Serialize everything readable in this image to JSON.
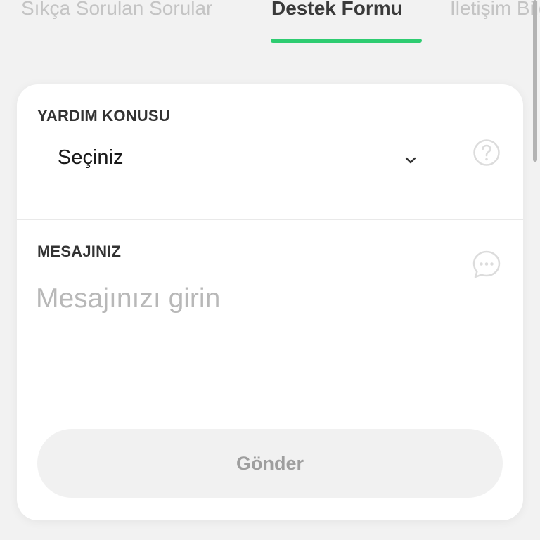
{
  "tabs": [
    {
      "label": "Sıkça Sorulan Sorular",
      "active": false
    },
    {
      "label": "Destek Formu",
      "active": true
    },
    {
      "label": "İletişim Bilgileri",
      "active": false
    }
  ],
  "form": {
    "subject": {
      "label": "YARDIM KONUSU",
      "selected": "Seçiniz",
      "icon": "help-circle-icon"
    },
    "message": {
      "label": "MESAJINIZ",
      "placeholder": "Mesajınızı girin",
      "value": "",
      "icon": "chat-bubble-icon"
    },
    "submit_label": "Gönder"
  },
  "colors": {
    "accent": "#2ecc71",
    "active_tab_text": "#3a3a3a",
    "inactive_tab_text": "#c4c4c4",
    "background": "#f2f2f2",
    "card": "#ffffff",
    "button_bg": "#f1f1f1",
    "button_text": "#9e9e9e"
  }
}
